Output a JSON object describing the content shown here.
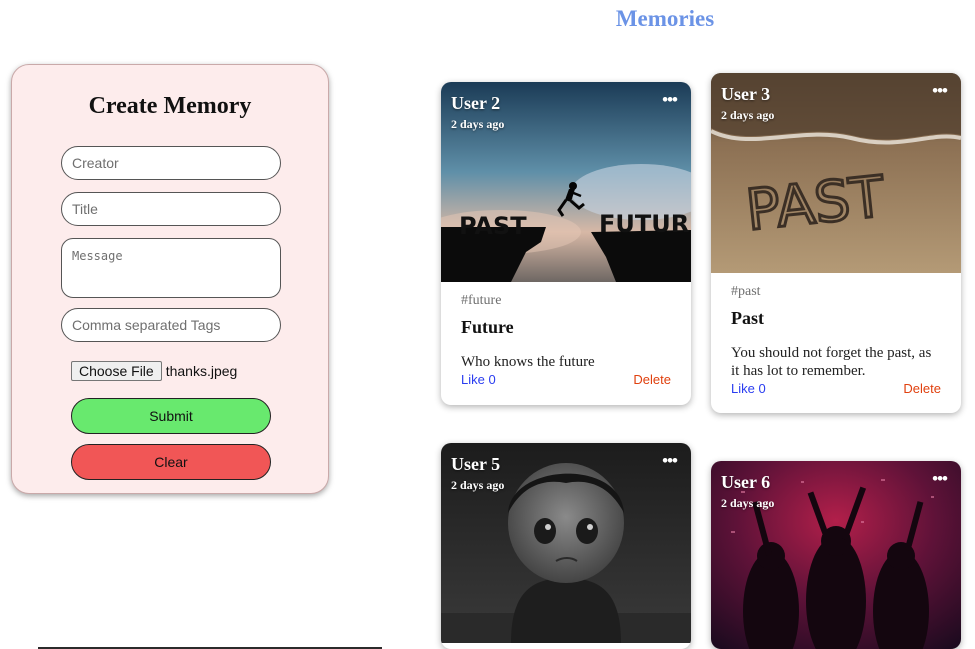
{
  "app": {
    "title": "Memories"
  },
  "form": {
    "title": "Create Memory",
    "creator_placeholder": "Creator",
    "title_placeholder": "Title",
    "message_placeholder": "Message",
    "tags_placeholder": "Comma separated Tags",
    "file_button": "Choose File",
    "file_name": "thanks.jpeg",
    "submit_label": "Submit",
    "clear_label": "Clear"
  },
  "posts": [
    {
      "creator": "User 2",
      "time": "2 days ago",
      "more": "•••",
      "tags": "#future",
      "title": "Future",
      "message": "Who knows the future",
      "like": "Like 0",
      "delete": "Delete",
      "image_words": [
        "PAST",
        "FUTURE"
      ]
    },
    {
      "creator": "User 3",
      "time": "2 days ago",
      "more": "•••",
      "tags": "#past",
      "title": "Past",
      "message": "You should not forget the past, as it has lot to remember.",
      "like": "Like 0",
      "delete": "Delete",
      "image_words": [
        "PAST"
      ]
    },
    {
      "creator": "User 5",
      "time": "2 days ago",
      "more": "•••"
    },
    {
      "creator": "User 6",
      "time": "2 days ago",
      "more": "•••"
    }
  ]
}
